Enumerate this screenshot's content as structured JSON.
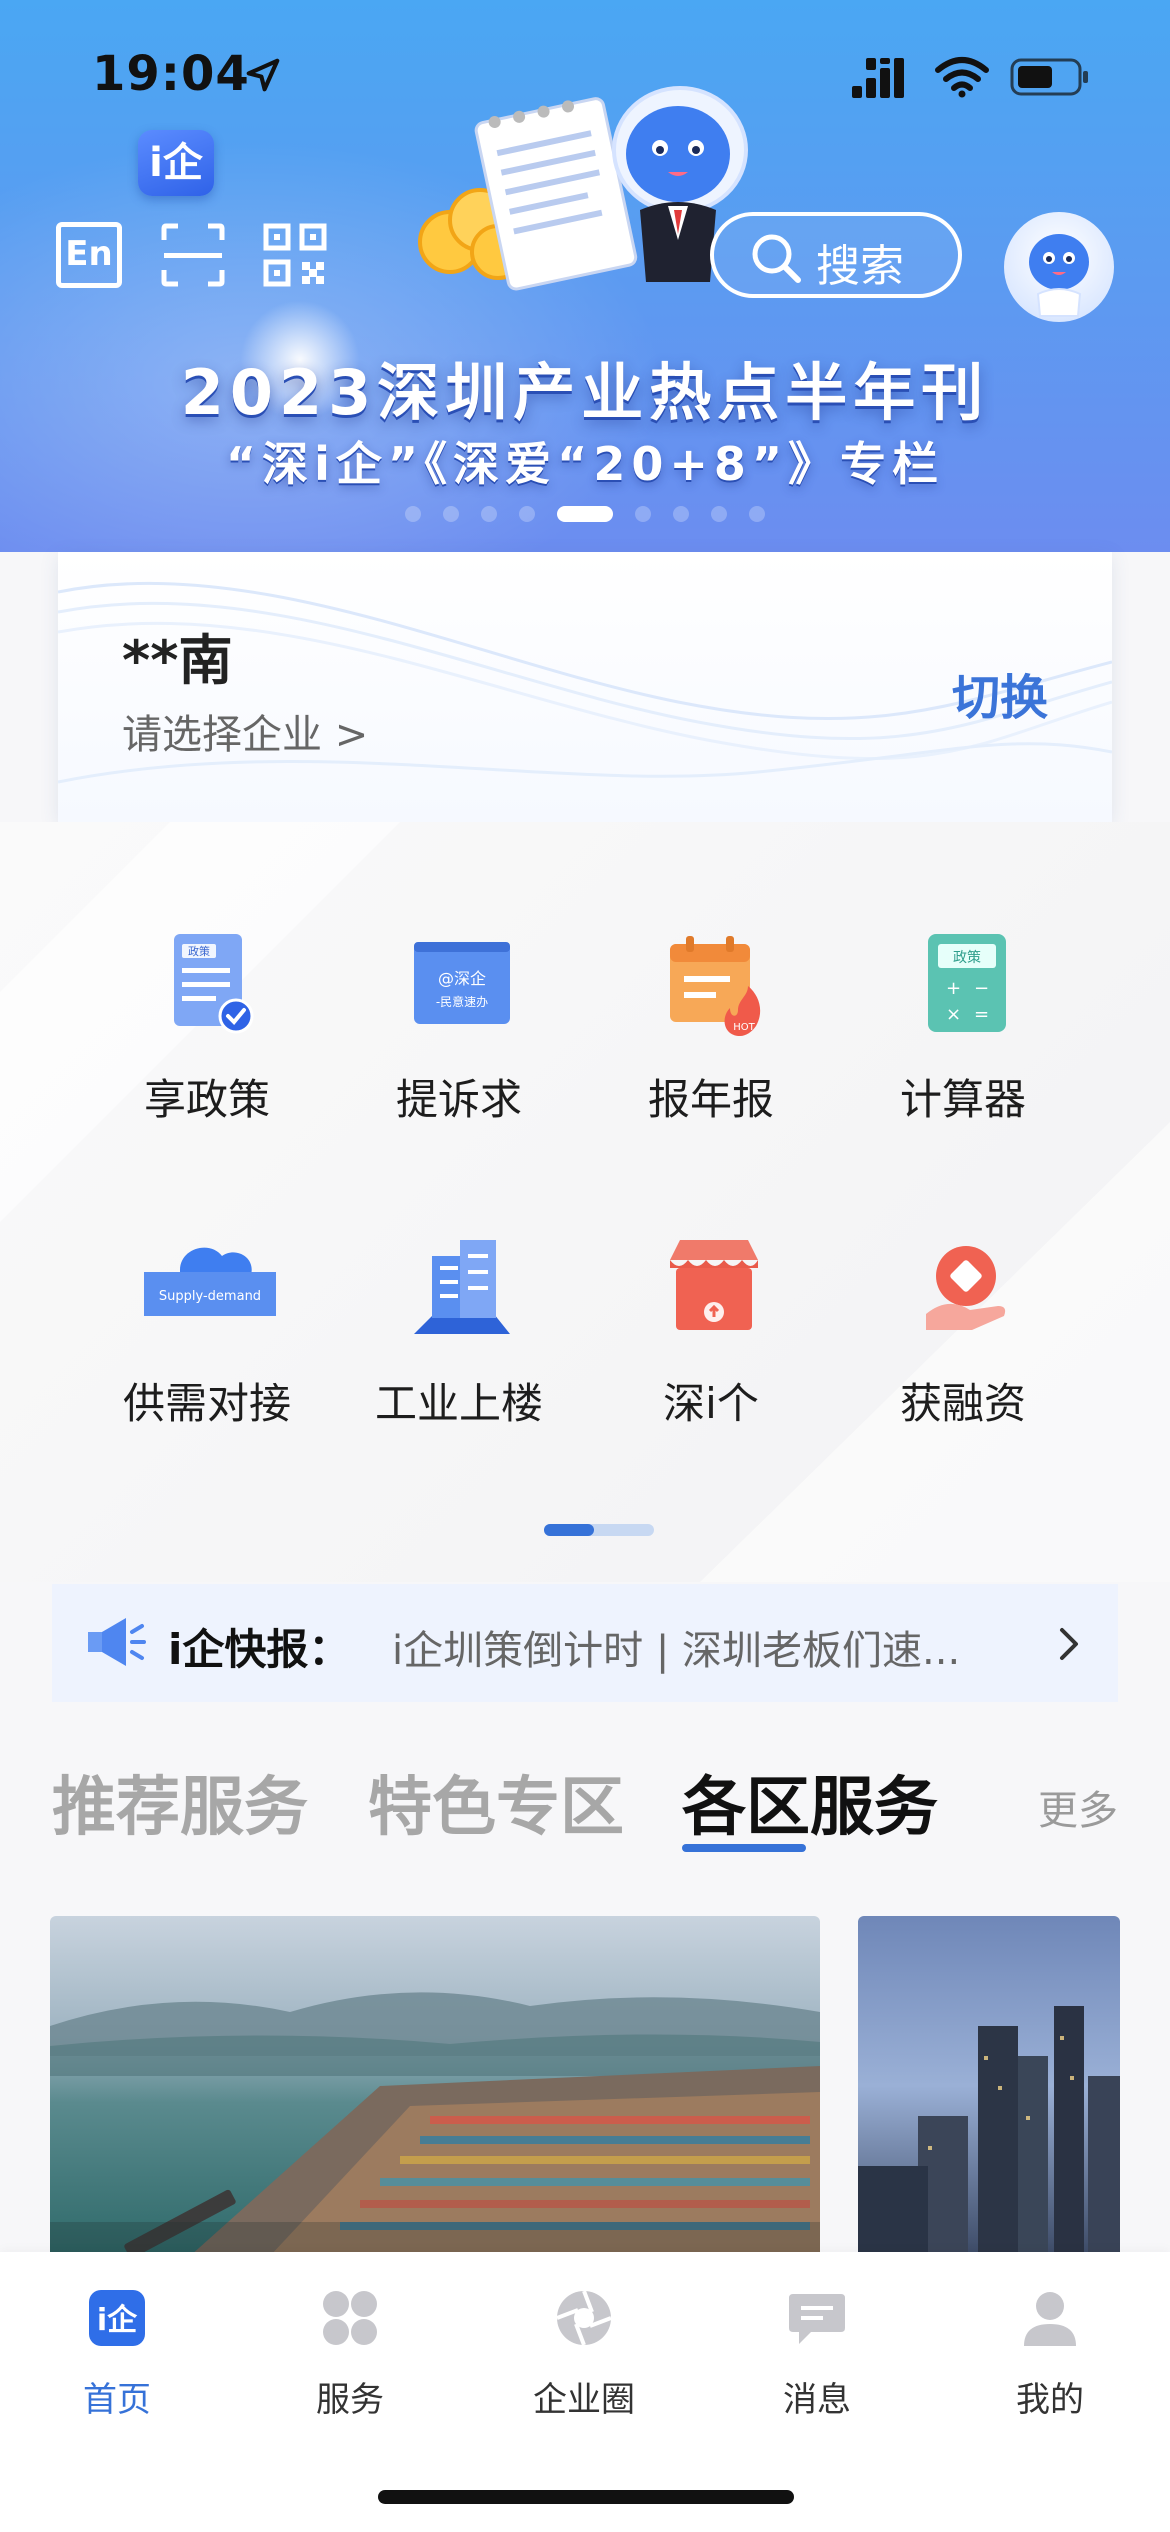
{
  "status_bar": {
    "time": "19:04"
  },
  "hero": {
    "logo_text": "i企",
    "en_label": "En",
    "search_label": "搜索",
    "title": "2023深圳产业热点半年刊",
    "subtitle": "“深i企”《深爱“20+8”》专栏",
    "pager_count": 9,
    "pager_active": 4
  },
  "company": {
    "name": "**南",
    "select_label": "请选择企业 >",
    "switch_label": "切换"
  },
  "services": [
    {
      "label": "享政策",
      "icon": "policy-doc-icon"
    },
    {
      "label": "提诉求",
      "icon": "appeal-icon"
    },
    {
      "label": "报年报",
      "icon": "annual-report-icon"
    },
    {
      "label": "计算器",
      "icon": "calculator-icon"
    },
    {
      "label": "供需对接",
      "icon": "supply-demand-icon"
    },
    {
      "label": "工业上楼",
      "icon": "industrial-building-icon"
    },
    {
      "label": "深i个",
      "icon": "shop-icon"
    },
    {
      "label": "获融资",
      "icon": "financing-icon"
    }
  ],
  "icon_texts": {
    "policy": "政策",
    "appeal_top": "@深企",
    "appeal_bottom": "-民意速办",
    "hot": "HOT",
    "calc": "政策",
    "supply": "Supply-demand"
  },
  "ticker": {
    "title": "i企快报：",
    "text": "i企圳策倒计时 | 深圳老板们速..."
  },
  "tabs": {
    "items": [
      "推荐服务",
      "特色专区",
      "各区服务"
    ],
    "active": 2,
    "more": "更多"
  },
  "bottom_nav": [
    {
      "label": "首页",
      "icon": "home-icon",
      "active": true
    },
    {
      "label": "服务",
      "icon": "services-grid-icon",
      "active": false
    },
    {
      "label": "企业圈",
      "icon": "enterprise-circle-icon",
      "active": false
    },
    {
      "label": "消息",
      "icon": "message-icon",
      "active": false
    },
    {
      "label": "我的",
      "icon": "profile-icon",
      "active": false
    }
  ],
  "colors": {
    "accent": "#3672d8",
    "hero_top": "#4aa7f3",
    "hero_bottom": "#6c8df0",
    "ticker_bg": "#eef3fe"
  }
}
